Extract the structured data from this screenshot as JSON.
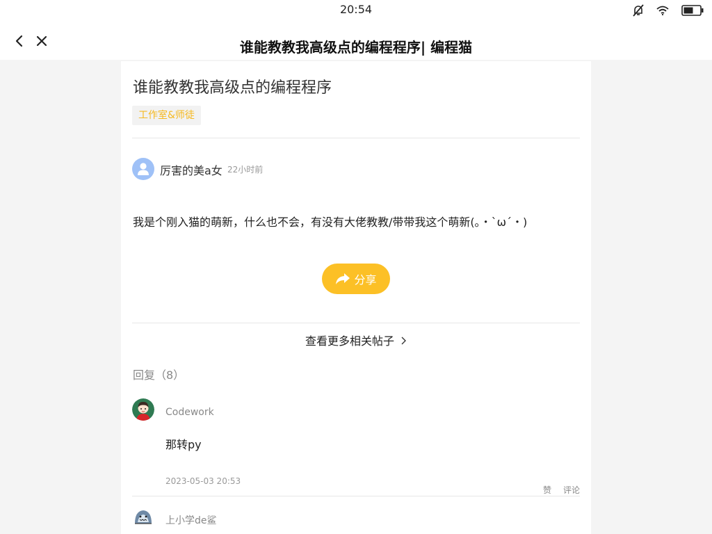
{
  "status_bar": {
    "time": "20:54"
  },
  "header": {
    "title": "谁能教教我高级点的编程程序| 编程猫"
  },
  "post": {
    "title": "谁能教教我高级点的编程程序",
    "tag": "工作室&师徒",
    "author": "厉害的美a女",
    "time_ago": "22小时前",
    "body": "我是个刚入猫的萌新，什么也不会，有没有大佬教教/带带我这个萌新(｡・`ω´・)",
    "share_label": "分享",
    "more_posts_label": "查看更多相关帖子"
  },
  "replies": {
    "heading": "回复（8）",
    "items": [
      {
        "user": "Codework",
        "text": "那转py",
        "date": "2023-05-03 20:53",
        "like_label": "赞",
        "comment_label": "评论"
      },
      {
        "user": "上小学de鲨"
      }
    ]
  },
  "colors": {
    "accent": "#fcc026",
    "tag_text": "#f5b921",
    "avatar_default": "#9fc1f7",
    "background": "#f4f4f4"
  },
  "icons": [
    "mute-icon",
    "wifi-icon",
    "battery-icon",
    "back-icon",
    "close-icon",
    "share-icon",
    "chevron-right-icon",
    "user-icon"
  ]
}
